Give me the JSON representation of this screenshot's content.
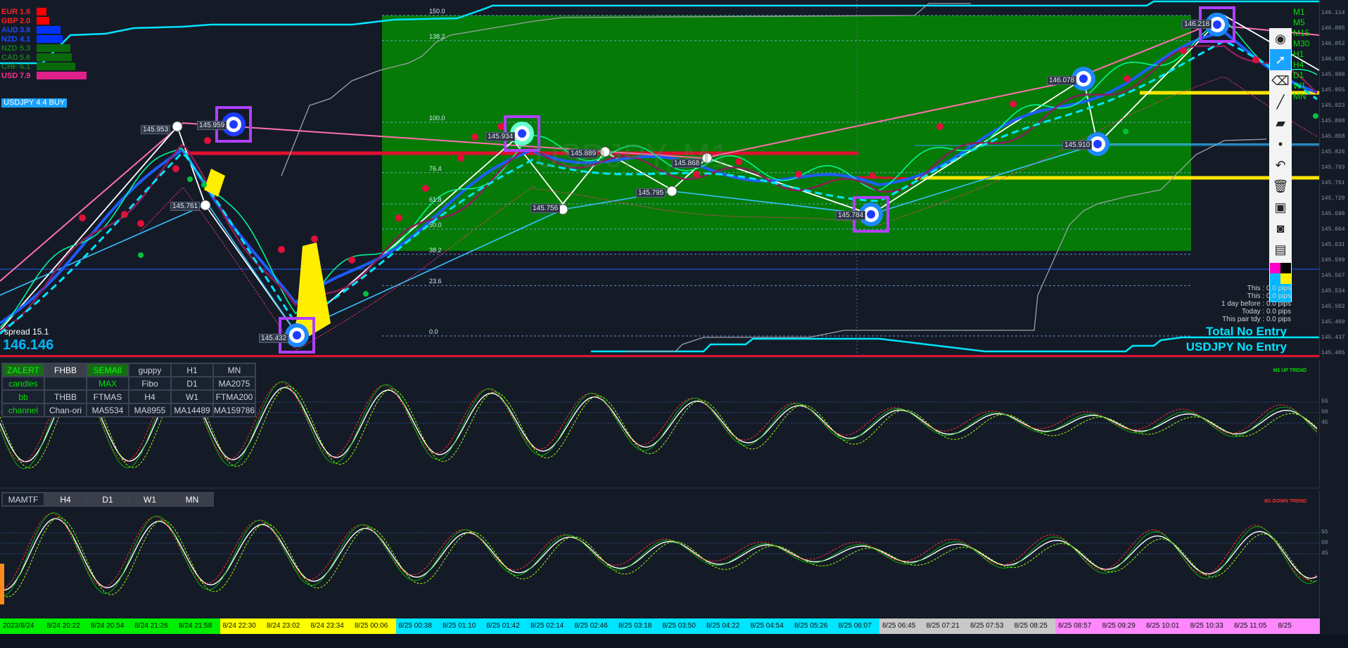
{
  "symbol_watermark": "USDJPY, M1",
  "currency_strength": [
    {
      "code": "EUR",
      "value": "1.6",
      "color": "#ff2020",
      "bar": "#ff0000",
      "bar_fraction": 0.16
    },
    {
      "code": "GBP",
      "value": "2.0",
      "color": "#ff2020",
      "bar": "#ff0000",
      "bar_fraction": 0.2
    },
    {
      "code": "AUD",
      "value": "3.8",
      "color": "#1a4bff",
      "bar": "#0033ff",
      "bar_fraction": 0.38
    },
    {
      "code": "NZD",
      "value": "4.1",
      "color": "#1a4bff",
      "bar": "#0033ff",
      "bar_fraction": 0.41
    },
    {
      "code": "NZD",
      "value": "5.3",
      "color": "#1a7a1a",
      "bar": "#0a6a0a",
      "bar_fraction": 0.53
    },
    {
      "code": "CAD",
      "value": "5.6",
      "color": "#1a7a1a",
      "bar": "#0a6a0a",
      "bar_fraction": 0.56
    },
    {
      "code": "CHF",
      "value": "6.1",
      "color": "#1a7a1a",
      "bar": "#0a6a0a",
      "bar_fraction": 0.61
    },
    {
      "code": "USD",
      "value": "7.9",
      "color": "#ff2e9a",
      "bar": "#e0208a",
      "bar_fraction": 0.79
    }
  ],
  "pair_signal": "USDJPY 4.4 BUY",
  "spread_label": "spread 15.1",
  "current_price": "146.146",
  "fibo_levels": [
    {
      "label": "150.0",
      "level": 150
    },
    {
      "label": "138.2",
      "level": 138.2
    },
    {
      "label": "100.0",
      "level": 100
    },
    {
      "label": "76.4",
      "level": 76.4
    },
    {
      "label": "61.8",
      "level": 61.8
    },
    {
      "label": "50.0",
      "level": 50
    },
    {
      "label": "38.2",
      "level": 38.2
    },
    {
      "label": "23.6",
      "level": 23.6
    },
    {
      "label": "0.0",
      "level": 0
    }
  ],
  "price_labels": [
    "145.953",
    "145.959",
    "145.761",
    "145.432",
    "145.934",
    "145.889",
    "145.756",
    "145.795",
    "145.868",
    "145.784",
    "146.078",
    "145.910",
    "146.218"
  ],
  "right_axis_main": [
    "146.114",
    "146.085",
    "146.052",
    "146.020",
    "145.988",
    "145.955",
    "145.923",
    "145.890",
    "145.858",
    "145.826",
    "145.793",
    "145.761",
    "145.729",
    "145.696",
    "145.664",
    "145.631",
    "145.599",
    "145.567",
    "145.534",
    "145.502",
    "145.469",
    "145.437",
    "145.405"
  ],
  "timeframes": [
    "M1",
    "M5",
    "M15",
    "M30",
    "H1",
    "H4",
    "D1",
    "W1",
    "MN"
  ],
  "tools": [
    {
      "name": "eye-icon",
      "glyph": "◉"
    },
    {
      "name": "cursor-icon",
      "glyph": "➚"
    },
    {
      "name": "eraser-icon",
      "glyph": "⌫"
    },
    {
      "name": "pen-icon",
      "glyph": "╱"
    },
    {
      "name": "highlighter-icon",
      "glyph": "▰"
    },
    {
      "name": "dot-icon",
      "glyph": "•"
    },
    {
      "name": "undo-icon",
      "glyph": "↶"
    },
    {
      "name": "trash-icon",
      "glyph": "🗑"
    },
    {
      "name": "screen-icon",
      "glyph": "▣"
    },
    {
      "name": "camera-icon",
      "glyph": "◙"
    },
    {
      "name": "clipboard-icon",
      "glyph": "▤"
    }
  ],
  "pip_info": [
    "This : 0.0 pips",
    "This : 0.0 pips",
    "1 day before : 0.0 pips",
    "Today : 0.0 pips",
    "This pair tdy : 0.0 pips"
  ],
  "status_total": "Total No Entry",
  "status_pair": "USDJPY No Entry",
  "button_grid_1": [
    [
      "ZALERT",
      "FHBB",
      "SEMA8",
      "guppy",
      "H1",
      "MN"
    ],
    [
      "candles",
      "",
      "MAX",
      "Fibo",
      "D1",
      "MA2075"
    ],
    [
      "bb",
      "THBB",
      "FTMAS",
      "H4",
      "W1",
      "FTMA200"
    ],
    [
      "channel",
      "Chan-ori",
      "MA5534",
      "MA8955",
      "MA14489",
      "MA159786"
    ]
  ],
  "button_grid_2": [
    "MAMTF",
    "H4",
    "D1",
    "W1",
    "MN"
  ],
  "osc1_trend": "M1 UP TREND",
  "osc2_trend": "M1 DOWN TREND",
  "osc_levels": [
    "55",
    "50",
    "45"
  ],
  "time_labels": [
    {
      "text": "2023/8/24",
      "color": "#00ee00"
    },
    {
      "text": "8/24 20:22",
      "color": "#00ee00"
    },
    {
      "text": "8/24 20:54",
      "color": "#00ee00"
    },
    {
      "text": "8/24 21:26",
      "color": "#00ee00"
    },
    {
      "text": "8/24 21:58",
      "color": "#00ee00"
    },
    {
      "text": "8/24 22:30",
      "color": "#ffff00"
    },
    {
      "text": "8/24 23:02",
      "color": "#ffff00"
    },
    {
      "text": "8/24 23:34",
      "color": "#ffff00"
    },
    {
      "text": "8/25 00:06",
      "color": "#ffff00"
    },
    {
      "text": "8/25 00:38",
      "color": "#00e5ff"
    },
    {
      "text": "8/25 01:10",
      "color": "#00e5ff"
    },
    {
      "text": "8/25 01:42",
      "color": "#00e5ff"
    },
    {
      "text": "8/25 02:14",
      "color": "#00e5ff"
    },
    {
      "text": "8/25 02:46",
      "color": "#00e5ff"
    },
    {
      "text": "8/25 03:18",
      "color": "#00e5ff"
    },
    {
      "text": "8/25 03:50",
      "color": "#00e5ff"
    },
    {
      "text": "8/25 04:22",
      "color": "#00e5ff"
    },
    {
      "text": "8/25 04:54",
      "color": "#00e5ff"
    },
    {
      "text": "8/25 05:26",
      "color": "#00e5ff"
    },
    {
      "text": "8/25 06:07",
      "color": "#00e5ff"
    },
    {
      "text": "8/25 06:45",
      "color": "#c8c8c8"
    },
    {
      "text": "8/25 07:21",
      "color": "#c8c8c8"
    },
    {
      "text": "8/25 07:53",
      "color": "#c8c8c8"
    },
    {
      "text": "8/25 08:25",
      "color": "#c8c8c8"
    },
    {
      "text": "8/25 08:57",
      "color": "#ff88ff"
    },
    {
      "text": "8/25 09:29",
      "color": "#ff88ff"
    },
    {
      "text": "8/25 10:01",
      "color": "#ff88ff"
    },
    {
      "text": "8/25 10:33",
      "color": "#ff88ff"
    },
    {
      "text": "8/25 11:05",
      "color": "#ff88ff"
    },
    {
      "text": "8/25",
      "color": "#ff88ff"
    }
  ],
  "colors": {
    "background": "#141b27",
    "green_zone": "#067a06",
    "red_line": "#e01030",
    "yellow_line": "#ffe600",
    "cyan_line": "#00e5ff",
    "pink_line": "#ff6fb0"
  }
}
